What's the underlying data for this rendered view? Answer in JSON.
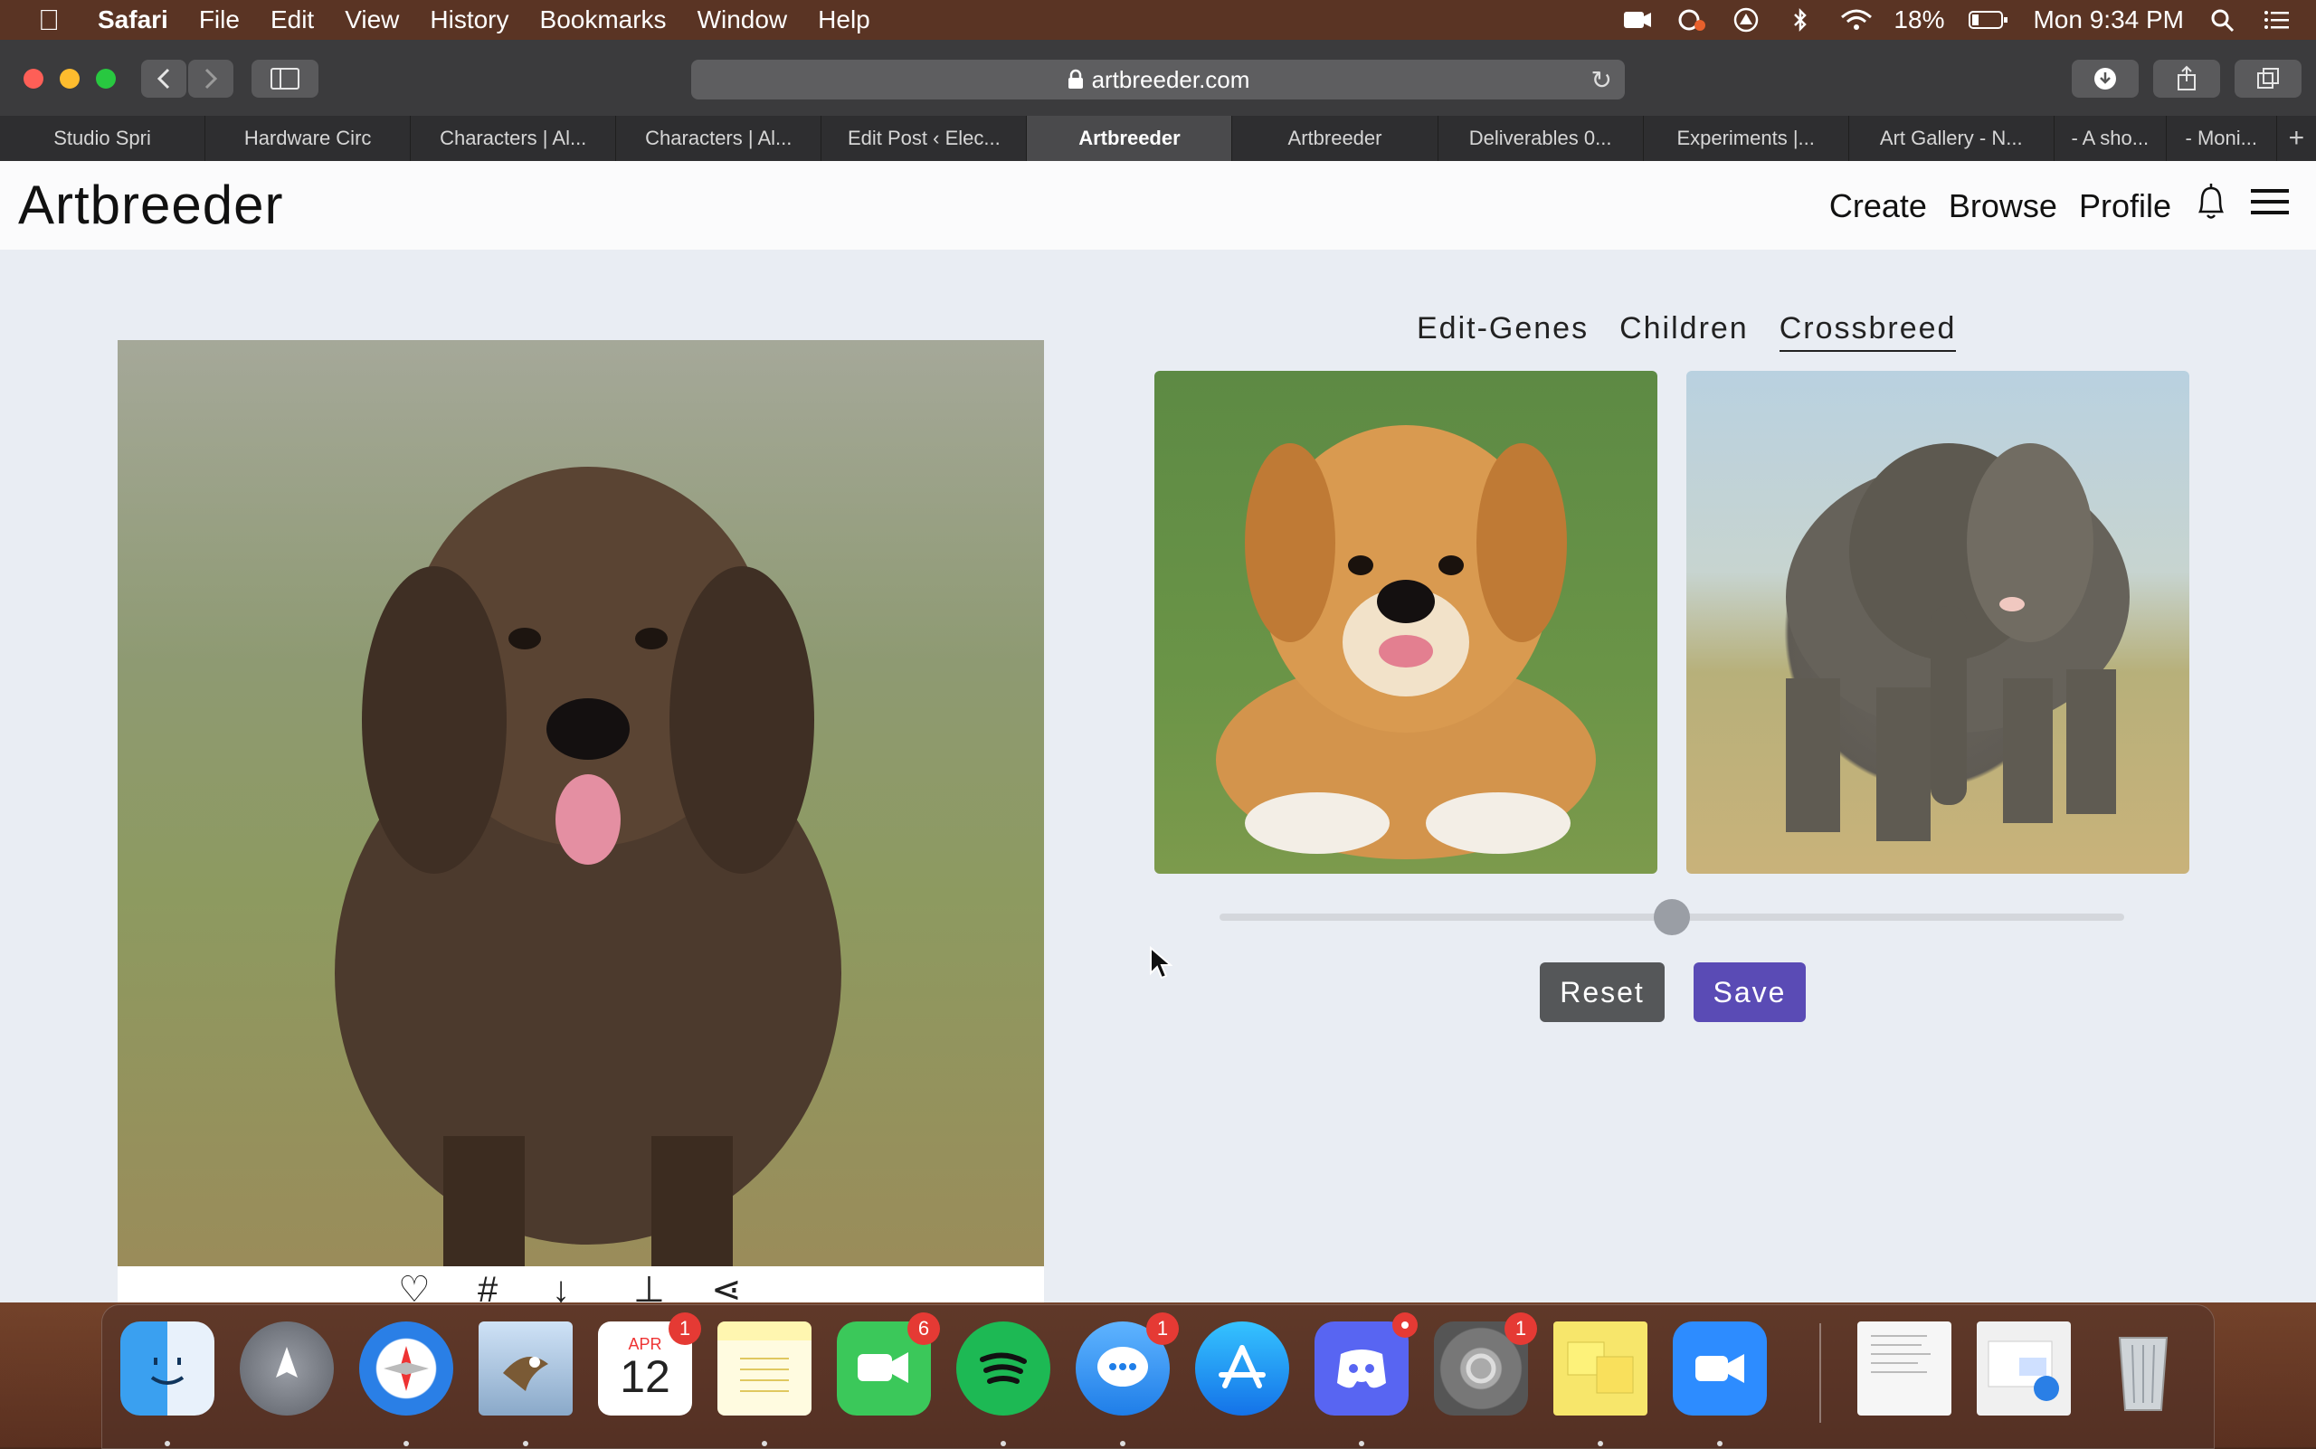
{
  "menubar": {
    "app_name": "Safari",
    "menus": [
      "File",
      "Edit",
      "View",
      "History",
      "Bookmarks",
      "Window",
      "Help"
    ],
    "battery": "18%",
    "clock": "Mon 9:34 PM"
  },
  "browser": {
    "url": "artbreeder.com",
    "tabs": [
      {
        "label": "Studio Spri"
      },
      {
        "label": "Hardware Circ"
      },
      {
        "label": "Characters | Al..."
      },
      {
        "label": "Characters | Al..."
      },
      {
        "label": "Edit Post ‹ Elec..."
      },
      {
        "label": "Artbreeder",
        "active": true
      },
      {
        "label": "Artbreeder"
      },
      {
        "label": "Deliverables 0..."
      },
      {
        "label": "Experiments |..."
      },
      {
        "label": "Art Gallery - N..."
      },
      {
        "label": "- A sho..."
      },
      {
        "label": "- Moni..."
      }
    ]
  },
  "site": {
    "logo": "Artbreeder",
    "nav": [
      "Create",
      "Browse",
      "Profile"
    ]
  },
  "panel": {
    "tabs": [
      {
        "label": "Edit-Genes"
      },
      {
        "label": "Children"
      },
      {
        "label": "Crossbreed",
        "active": true
      }
    ],
    "crossbreed_ratio": 0.5,
    "reset_label": "Reset",
    "save_label": "Save"
  },
  "dock": {
    "calendar_month": "APR",
    "calendar_day": "12",
    "badges": {
      "calendar": "1",
      "facetime": "6",
      "messages": "1",
      "system_prefs": "1"
    }
  },
  "colors": {
    "accent_save": "#5a4bb5",
    "reset_gray": "#555759",
    "badge_red": "#e53a34"
  }
}
